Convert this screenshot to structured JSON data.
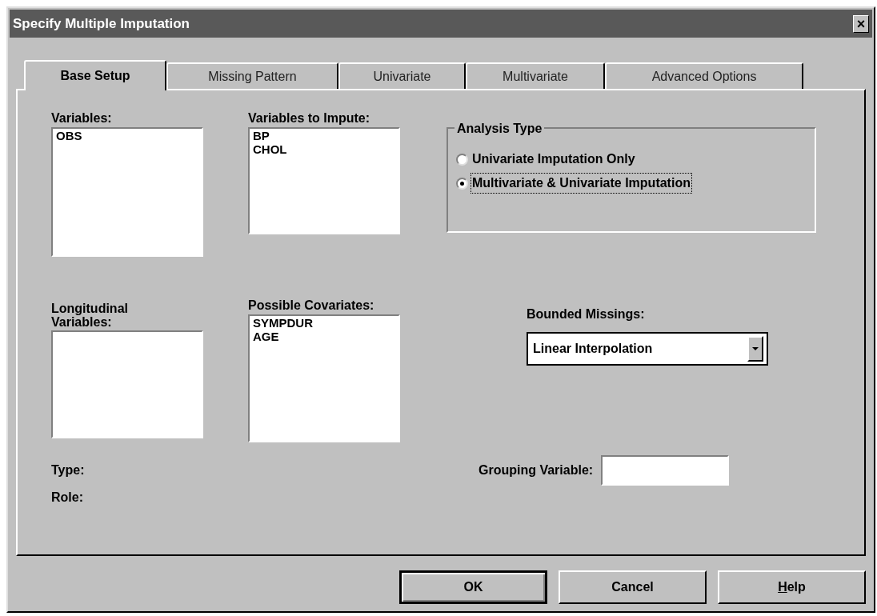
{
  "window": {
    "title": "Specify Multiple Imputation",
    "close": "×"
  },
  "tabs": [
    {
      "label": "Base Setup",
      "selected": true
    },
    {
      "label": "Missing Pattern",
      "selected": false
    },
    {
      "label": "Univariate",
      "selected": false
    },
    {
      "label": "Multivariate",
      "selected": false
    },
    {
      "label": "Advanced Options",
      "selected": false
    }
  ],
  "variables": {
    "label": "Variables:",
    "items": [
      "OBS"
    ]
  },
  "variables_to_impute": {
    "label": "Variables to Impute:",
    "items": [
      "BP",
      "CHOL"
    ]
  },
  "analysis_type": {
    "label": "Analysis Type",
    "options": [
      {
        "label": "Univariate Imputation Only",
        "selected": false
      },
      {
        "label": "Multivariate & Univariate Imputation",
        "selected": true
      }
    ]
  },
  "longitudinal_variables": {
    "label": "Longitudinal Variables:"
  },
  "possible_covariates": {
    "label": "Possible Covariates:",
    "items": [
      "SYMPDUR",
      "AGE"
    ]
  },
  "bounded_missings": {
    "label": "Bounded Missings:",
    "value": "Linear Interpolation"
  },
  "type_label": "Type:",
  "role_label": "Role:",
  "grouping_variable": {
    "label": "Grouping Variable:"
  },
  "buttons": [
    {
      "label": "OK",
      "default": true,
      "underline_first": false
    },
    {
      "label": "Cancel",
      "default": false,
      "underline_first": false
    },
    {
      "label": "Help",
      "default": false,
      "underline_first": true
    }
  ]
}
